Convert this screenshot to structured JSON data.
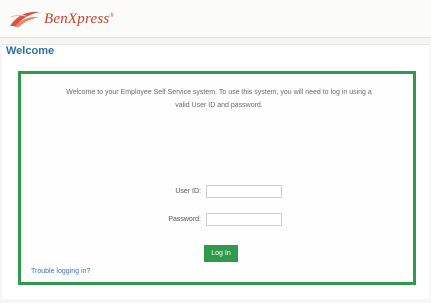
{
  "header": {
    "logo_text": "BenXpress",
    "logo_tm": "®",
    "brand_color": "#c8402f"
  },
  "main": {
    "heading": "Welcome",
    "intro_line1": "Welcome to your Employee Self Service system. To use this system, you will need to log in using a",
    "intro_line2": "valid User ID and password.",
    "user_id_label": "User ID:",
    "user_id_value": "",
    "password_label": "Password:",
    "password_value": "",
    "login_label": "Log In",
    "trouble_link": "Trouble logging in?",
    "accent_color": "#2f9a4c",
    "heading_color": "#2e6da4"
  }
}
